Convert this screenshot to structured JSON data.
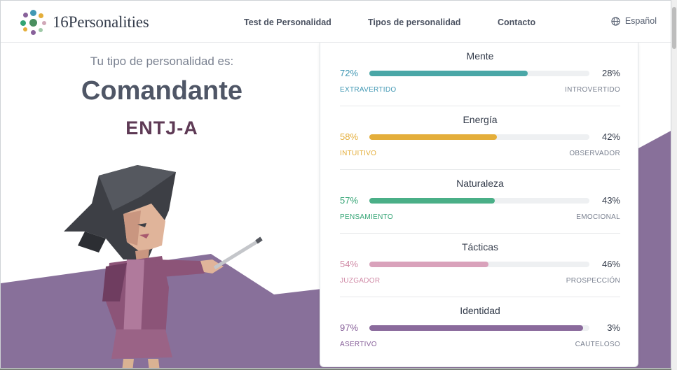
{
  "header": {
    "logo_text": "16Personalities",
    "nav": [
      {
        "label": "Test de Personalidad"
      },
      {
        "label": "Tipos de personalidad"
      },
      {
        "label": "Contacto"
      }
    ],
    "language": "Español",
    "logo_dot_colors": [
      "#33a474",
      "#4298b4",
      "#e4ae3a",
      "#88619a",
      "#d0a8b8",
      "#9fc9a7"
    ]
  },
  "result": {
    "intro": "Tu tipo de personalidad es:",
    "type_name": "Comandante",
    "type_code": "ENTJ-A"
  },
  "traits": [
    {
      "title": "Mente",
      "left_pct": "72%",
      "right_pct": "28%",
      "fill": 0.72,
      "left_label": "EXTRAVERTIDO",
      "right_label": "INTROVERTIDO",
      "color": "#4298b4",
      "bar_color": "#4aa7a7"
    },
    {
      "title": "Energía",
      "left_pct": "58%",
      "right_pct": "42%",
      "fill": 0.58,
      "left_label": "INTUITIVO",
      "right_label": "OBSERVADOR",
      "color": "#e4ae3a",
      "bar_color": "#e4ae3a"
    },
    {
      "title": "Naturaleza",
      "left_pct": "57%",
      "right_pct": "43%",
      "fill": 0.57,
      "left_label": "PENSAMIENTO",
      "right_label": "EMOCIONAL",
      "color": "#33a474",
      "bar_color": "#4aaf87"
    },
    {
      "title": "Tácticas",
      "left_pct": "54%",
      "right_pct": "46%",
      "fill": 0.54,
      "left_label": "JUZGADOR",
      "right_label": "PROSPECCIÓN",
      "color": "#d08aa6",
      "bar_color": "#d9a2bb"
    },
    {
      "title": "Identidad",
      "left_pct": "97%",
      "right_pct": "3%",
      "fill": 0.97,
      "left_label": "ASERTIVO",
      "right_label": "CAUTELOSO",
      "color": "#88619a",
      "bar_color": "#8a6a9c"
    }
  ],
  "theme": {
    "purple_band": "#88709a"
  }
}
